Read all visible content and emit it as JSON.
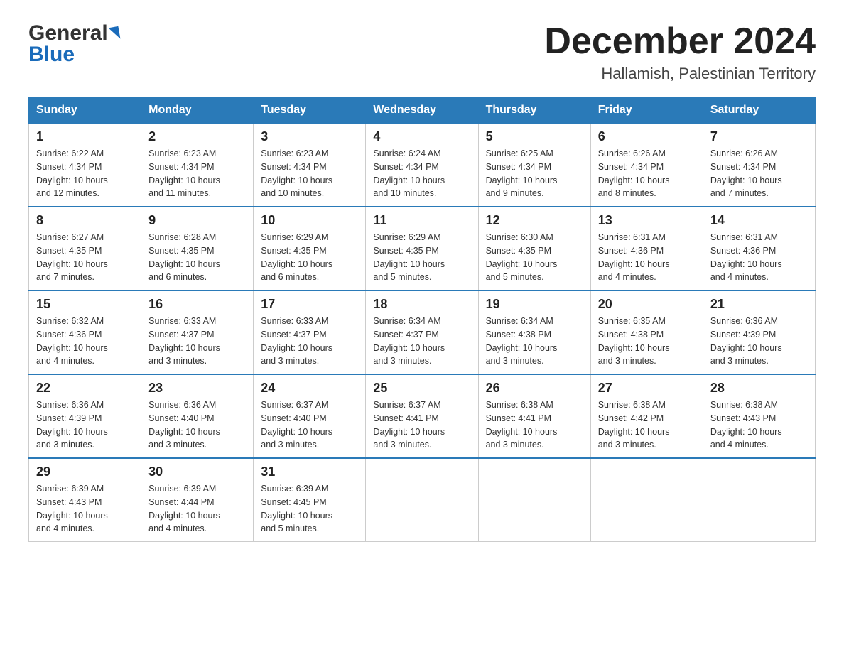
{
  "header": {
    "logo_line1": "General",
    "logo_line2": "Blue",
    "month_title": "December 2024",
    "location": "Hallamish, Palestinian Territory"
  },
  "columns": [
    "Sunday",
    "Monday",
    "Tuesday",
    "Wednesday",
    "Thursday",
    "Friday",
    "Saturday"
  ],
  "weeks": [
    [
      {
        "day": "1",
        "sunrise": "6:22 AM",
        "sunset": "4:34 PM",
        "daylight": "10 hours and 12 minutes."
      },
      {
        "day": "2",
        "sunrise": "6:23 AM",
        "sunset": "4:34 PM",
        "daylight": "10 hours and 11 minutes."
      },
      {
        "day": "3",
        "sunrise": "6:23 AM",
        "sunset": "4:34 PM",
        "daylight": "10 hours and 10 minutes."
      },
      {
        "day": "4",
        "sunrise": "6:24 AM",
        "sunset": "4:34 PM",
        "daylight": "10 hours and 10 minutes."
      },
      {
        "day": "5",
        "sunrise": "6:25 AM",
        "sunset": "4:34 PM",
        "daylight": "10 hours and 9 minutes."
      },
      {
        "day": "6",
        "sunrise": "6:26 AM",
        "sunset": "4:34 PM",
        "daylight": "10 hours and 8 minutes."
      },
      {
        "day": "7",
        "sunrise": "6:26 AM",
        "sunset": "4:34 PM",
        "daylight": "10 hours and 7 minutes."
      }
    ],
    [
      {
        "day": "8",
        "sunrise": "6:27 AM",
        "sunset": "4:35 PM",
        "daylight": "10 hours and 7 minutes."
      },
      {
        "day": "9",
        "sunrise": "6:28 AM",
        "sunset": "4:35 PM",
        "daylight": "10 hours and 6 minutes."
      },
      {
        "day": "10",
        "sunrise": "6:29 AM",
        "sunset": "4:35 PM",
        "daylight": "10 hours and 6 minutes."
      },
      {
        "day": "11",
        "sunrise": "6:29 AM",
        "sunset": "4:35 PM",
        "daylight": "10 hours and 5 minutes."
      },
      {
        "day": "12",
        "sunrise": "6:30 AM",
        "sunset": "4:35 PM",
        "daylight": "10 hours and 5 minutes."
      },
      {
        "day": "13",
        "sunrise": "6:31 AM",
        "sunset": "4:36 PM",
        "daylight": "10 hours and 4 minutes."
      },
      {
        "day": "14",
        "sunrise": "6:31 AM",
        "sunset": "4:36 PM",
        "daylight": "10 hours and 4 minutes."
      }
    ],
    [
      {
        "day": "15",
        "sunrise": "6:32 AM",
        "sunset": "4:36 PM",
        "daylight": "10 hours and 4 minutes."
      },
      {
        "day": "16",
        "sunrise": "6:33 AM",
        "sunset": "4:37 PM",
        "daylight": "10 hours and 3 minutes."
      },
      {
        "day": "17",
        "sunrise": "6:33 AM",
        "sunset": "4:37 PM",
        "daylight": "10 hours and 3 minutes."
      },
      {
        "day": "18",
        "sunrise": "6:34 AM",
        "sunset": "4:37 PM",
        "daylight": "10 hours and 3 minutes."
      },
      {
        "day": "19",
        "sunrise": "6:34 AM",
        "sunset": "4:38 PM",
        "daylight": "10 hours and 3 minutes."
      },
      {
        "day": "20",
        "sunrise": "6:35 AM",
        "sunset": "4:38 PM",
        "daylight": "10 hours and 3 minutes."
      },
      {
        "day": "21",
        "sunrise": "6:36 AM",
        "sunset": "4:39 PM",
        "daylight": "10 hours and 3 minutes."
      }
    ],
    [
      {
        "day": "22",
        "sunrise": "6:36 AM",
        "sunset": "4:39 PM",
        "daylight": "10 hours and 3 minutes."
      },
      {
        "day": "23",
        "sunrise": "6:36 AM",
        "sunset": "4:40 PM",
        "daylight": "10 hours and 3 minutes."
      },
      {
        "day": "24",
        "sunrise": "6:37 AM",
        "sunset": "4:40 PM",
        "daylight": "10 hours and 3 minutes."
      },
      {
        "day": "25",
        "sunrise": "6:37 AM",
        "sunset": "4:41 PM",
        "daylight": "10 hours and 3 minutes."
      },
      {
        "day": "26",
        "sunrise": "6:38 AM",
        "sunset": "4:41 PM",
        "daylight": "10 hours and 3 minutes."
      },
      {
        "day": "27",
        "sunrise": "6:38 AM",
        "sunset": "4:42 PM",
        "daylight": "10 hours and 3 minutes."
      },
      {
        "day": "28",
        "sunrise": "6:38 AM",
        "sunset": "4:43 PM",
        "daylight": "10 hours and 4 minutes."
      }
    ],
    [
      {
        "day": "29",
        "sunrise": "6:39 AM",
        "sunset": "4:43 PM",
        "daylight": "10 hours and 4 minutes."
      },
      {
        "day": "30",
        "sunrise": "6:39 AM",
        "sunset": "4:44 PM",
        "daylight": "10 hours and 4 minutes."
      },
      {
        "day": "31",
        "sunrise": "6:39 AM",
        "sunset": "4:45 PM",
        "daylight": "10 hours and 5 minutes."
      },
      null,
      null,
      null,
      null
    ]
  ],
  "labels": {
    "sunrise": "Sunrise:",
    "sunset": "Sunset:",
    "daylight": "Daylight:"
  }
}
